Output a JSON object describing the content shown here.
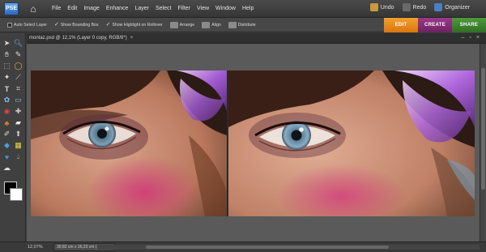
{
  "menubar": {
    "logo_text": "PSE",
    "menus": [
      "File",
      "Edit",
      "Image",
      "Enhance",
      "Layer",
      "Select",
      "Filter",
      "View",
      "Window",
      "Help"
    ],
    "undo_label": "Undo",
    "redo_label": "Redo",
    "organizer_label": "Organizer"
  },
  "options": {
    "auto_select": "Auto Select Layer",
    "show_bounding_box": "Show Bounding Box",
    "show_highlight": "Show Highlight on Rollover",
    "arrange": "Arrange",
    "align": "Align",
    "distribute": "Distribute"
  },
  "modes": {
    "edit": "EDIT",
    "create": "CREATE",
    "share": "SHARE",
    "colors": {
      "edit": "#e88a1f",
      "create": "#86307a",
      "share": "#3f8a30"
    }
  },
  "document": {
    "tab_title": "montaz.psd @ 12,1% (Layer 0 copy, RGB/8*)",
    "close_glyph": "×"
  },
  "status": {
    "zoom": "12,07%",
    "doc_size": "30,82 cm x 16,23 cm (240 ppi)"
  },
  "icons": {
    "home": "home-icon",
    "move": "move-tool-icon",
    "zoom": "zoom-tool-icon",
    "hand": "hand-tool-icon",
    "eyedropper": "eyedropper-tool-icon"
  }
}
